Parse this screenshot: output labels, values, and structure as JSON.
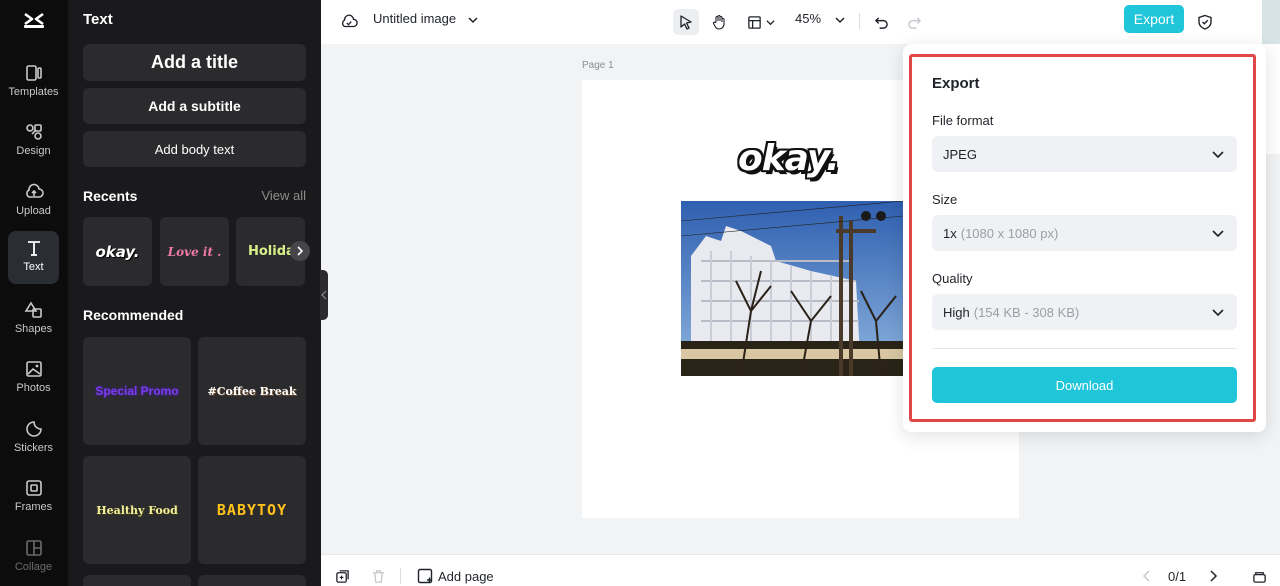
{
  "rail": {
    "items": [
      {
        "label": "Templates",
        "icon": "templates-icon"
      },
      {
        "label": "Design",
        "icon": "design-icon"
      },
      {
        "label": "Upload",
        "icon": "upload-icon"
      },
      {
        "label": "Text",
        "icon": "text-icon",
        "active": true
      },
      {
        "label": "Shapes",
        "icon": "shapes-icon"
      },
      {
        "label": "Photos",
        "icon": "photos-icon"
      },
      {
        "label": "Stickers",
        "icon": "stickers-icon"
      },
      {
        "label": "Frames",
        "icon": "frames-icon"
      },
      {
        "label": "Collage",
        "icon": "collage-icon"
      }
    ]
  },
  "panel": {
    "title": "Text",
    "add_title": "Add a title",
    "add_subtitle": "Add a subtitle",
    "add_body": "Add body text",
    "recents_title": "Recents",
    "view_all": "View all",
    "recents": [
      "okay.",
      "Love it .",
      "Holiday"
    ],
    "recommended_title": "Recommended",
    "recommended": [
      "Special Promo",
      "#Coffee Break",
      "Healthy Food",
      "BABYTOY"
    ]
  },
  "topbar": {
    "doc_title": "Untitled image",
    "zoom": "45%",
    "export_label": "Export"
  },
  "canvas": {
    "page_label": "Page 1",
    "text_element": "okay."
  },
  "export_panel": {
    "title": "Export",
    "file_format_label": "File format",
    "file_format_value": "JPEG",
    "size_label": "Size",
    "size_value": "1x",
    "size_detail": "(1080 x 1080 px)",
    "quality_label": "Quality",
    "quality_value": "High",
    "quality_detail": "(154 KB - 308 KB)",
    "download_label": "Download"
  },
  "bottombar": {
    "add_page": "Add page",
    "page_count": "0/1"
  },
  "colors": {
    "accent": "#1fc5d8",
    "highlight": "#e04848",
    "sidebar_bg": "#0c0c0c",
    "panel_bg": "#1a1a1c"
  }
}
